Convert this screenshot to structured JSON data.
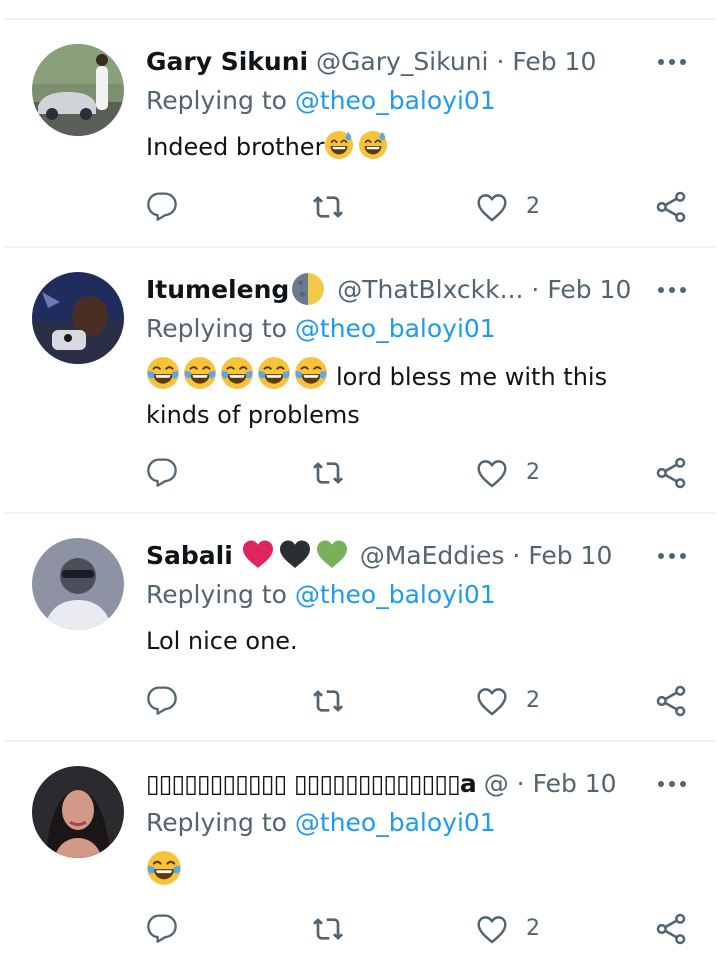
{
  "tweets": [
    {
      "name": "Gary Sikuni",
      "handle": "@Gary_Sikuni",
      "dot": "·",
      "date": "Feb 10",
      "replying_prefix": "Replying to",
      "replying_to": "@theo_baloyi01",
      "text": "Indeed brother",
      "emoji_suffix": [
        "sweat-smile",
        "sweat-smile"
      ],
      "likes": "2"
    },
    {
      "name": "Itumeleng",
      "name_emoji": "moon",
      "handle": "@ThatBlxckk...",
      "dot": "·",
      "date": "Feb 10",
      "replying_prefix": "Replying to",
      "replying_to": "@theo_baloyi01",
      "emoji_prefix": [
        "tears-of-joy",
        "tears-of-joy",
        "tears-of-joy",
        "tears-of-joy",
        "tears-of-joy"
      ],
      "text": "lord bless me with this kinds of problems",
      "likes": "2"
    },
    {
      "name": "Sabali",
      "name_emoji": [
        "red-heart",
        "black-heart",
        "green-heart"
      ],
      "handle": "@MaEddies",
      "dot": "·",
      "date": "Feb 10",
      "replying_prefix": "Replying to",
      "replying_to": "@theo_baloyi01",
      "text": "Lol nice one.",
      "likes": "2"
    },
    {
      "name": "▯▯▯▯▯▯▯▯▯▯▯ ▯▯▯▯▯▯▯▯▯▯▯▯▯a",
      "handle": "@",
      "dot": "·",
      "date": "Feb 10",
      "replying_prefix": "Replying to",
      "replying_to": "@theo_baloyi01",
      "emoji_prefix": [
        "tears-of-joy"
      ],
      "text": "",
      "likes": "2"
    }
  ],
  "icons": {
    "more": "more-icon",
    "reply": "reply-icon",
    "retweet": "retweet-icon",
    "like": "like-icon",
    "share": "share-icon"
  },
  "colors": {
    "link": "#1d9bf0",
    "secondary_text": "#536471",
    "divider": "#eff3f4"
  }
}
